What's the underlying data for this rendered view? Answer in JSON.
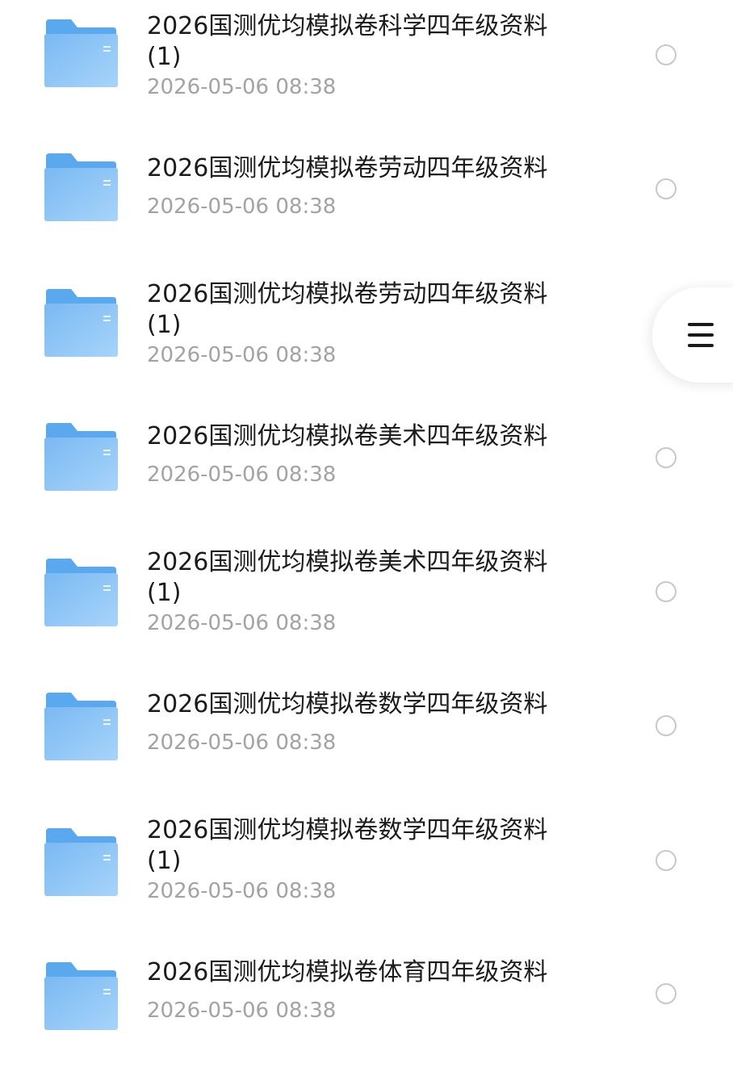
{
  "files": [
    {
      "name": "2026国测优均模拟卷科学四年级资料",
      "suffix": "(1)",
      "date": "2026-05-06 08:38"
    },
    {
      "name": "2026国测优均模拟卷劳动四年级资料",
      "suffix": "",
      "date": "2026-05-06 08:38"
    },
    {
      "name": "2026国测优均模拟卷劳动四年级资料",
      "suffix": "(1)",
      "date": "2026-05-06 08:38"
    },
    {
      "name": "2026国测优均模拟卷美术四年级资料",
      "suffix": "",
      "date": "2026-05-06 08:38"
    },
    {
      "name": "2026国测优均模拟卷美术四年级资料",
      "suffix": "(1)",
      "date": "2026-05-06 08:38"
    },
    {
      "name": "2026国测优均模拟卷数学四年级资料",
      "suffix": "",
      "date": "2026-05-06 08:38"
    },
    {
      "name": "2026国测优均模拟卷数学四年级资料",
      "suffix": "(1)",
      "date": "2026-05-06 08:38"
    },
    {
      "name": "2026国测优均模拟卷体育四年级资料",
      "suffix": "",
      "date": "2026-05-06 08:38"
    }
  ],
  "icons": {
    "folder": "folder-icon",
    "select": "radio-circle",
    "menu": "hamburger-menu-icon"
  },
  "colors": {
    "folder_back": "#5aa9ef",
    "folder_front": "#8cc6f7",
    "name_text": "#1b1b1b",
    "date_text": "#a3a3a3",
    "radio_border": "#c8c8c8"
  }
}
